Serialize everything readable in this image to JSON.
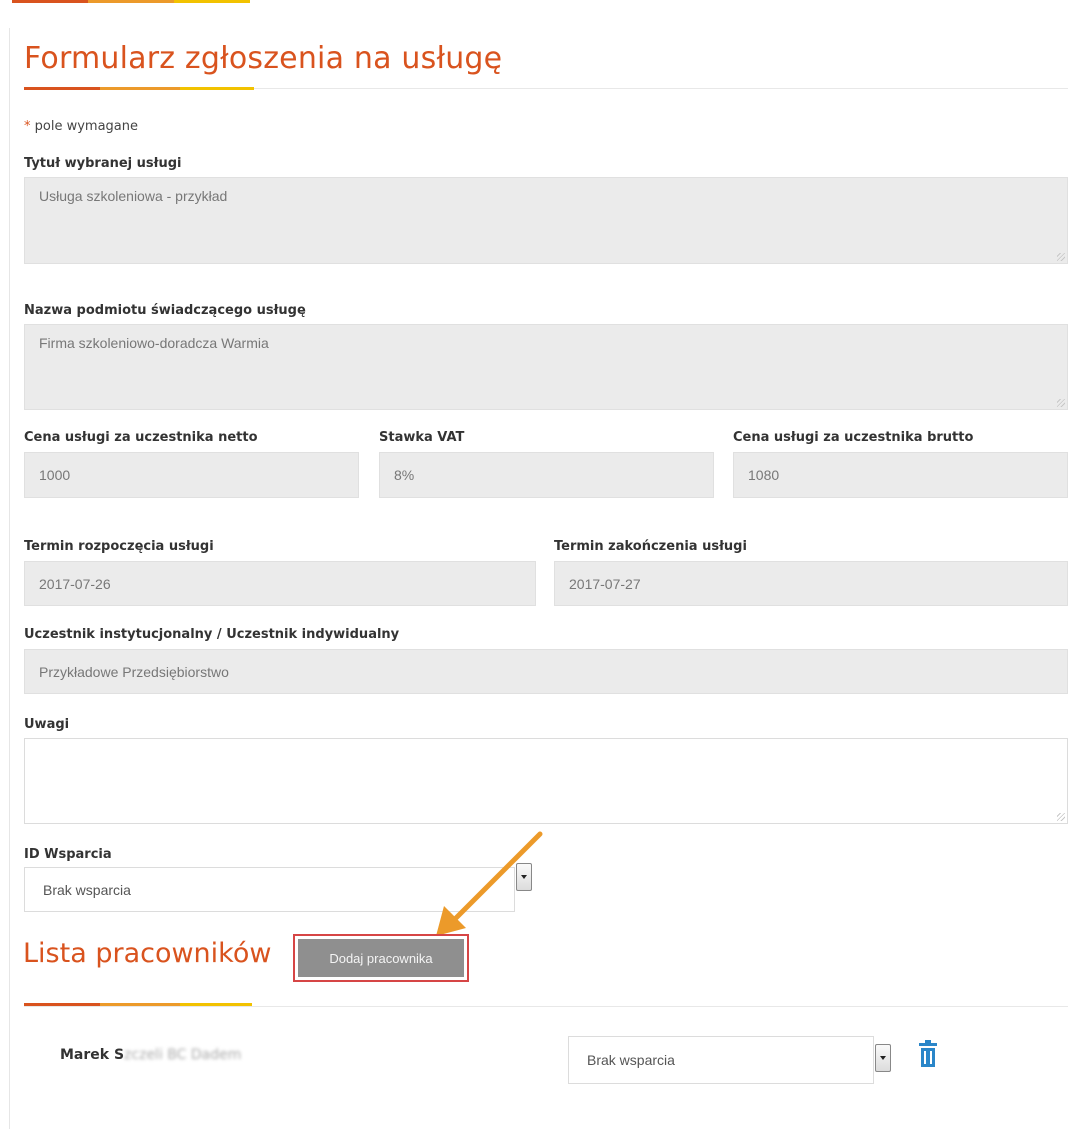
{
  "form": {
    "title": "Formularz zgłoszenia na usługę",
    "required_star": "*",
    "required_note": "pole wymagane",
    "service_title": {
      "label": "Tytuł wybranej usługi",
      "value": "Usługa szkoleniowa - przykład"
    },
    "provider": {
      "label": "Nazwa podmiotu świadczącego usługę",
      "value": "Firma szkoleniowo-doradcza Warmia"
    },
    "price_net": {
      "label": "Cena usługi za uczestnika netto",
      "value": "1000"
    },
    "vat": {
      "label": "Stawka VAT",
      "value": "8%"
    },
    "price_gross": {
      "label": "Cena usługi za uczestnika brutto",
      "value": "1080"
    },
    "start_date": {
      "label": "Termin rozpoczęcia usługi",
      "value": "2017-07-26"
    },
    "end_date": {
      "label": "Termin zakończenia usługi",
      "value": "2017-07-27"
    },
    "participant": {
      "label": "Uczestnik instytucjonalny / Uczestnik indywidualny",
      "value": "Przykładowe Przedsiębiorstwo"
    },
    "notes": {
      "label": "Uwagi",
      "value": ""
    },
    "support_id": {
      "label": "ID Wsparcia",
      "selected": "Brak wsparcia"
    }
  },
  "employees": {
    "title": "Lista pracowników",
    "add_button": "Dodaj pracownika",
    "rows": [
      {
        "name_visible": "Marek S",
        "name_blurred": "zczeli BC Dadem",
        "support": "Brak wsparcia",
        "delete_icon": "trash-icon"
      }
    ]
  },
  "colors": {
    "accent": "#d9531e",
    "stripe_orange": "#ec9a2a",
    "stripe_yellow": "#f2c200",
    "highlight_border": "#d64545",
    "trash_blue": "#2a86c9",
    "arrow": "#ec9a2a"
  }
}
